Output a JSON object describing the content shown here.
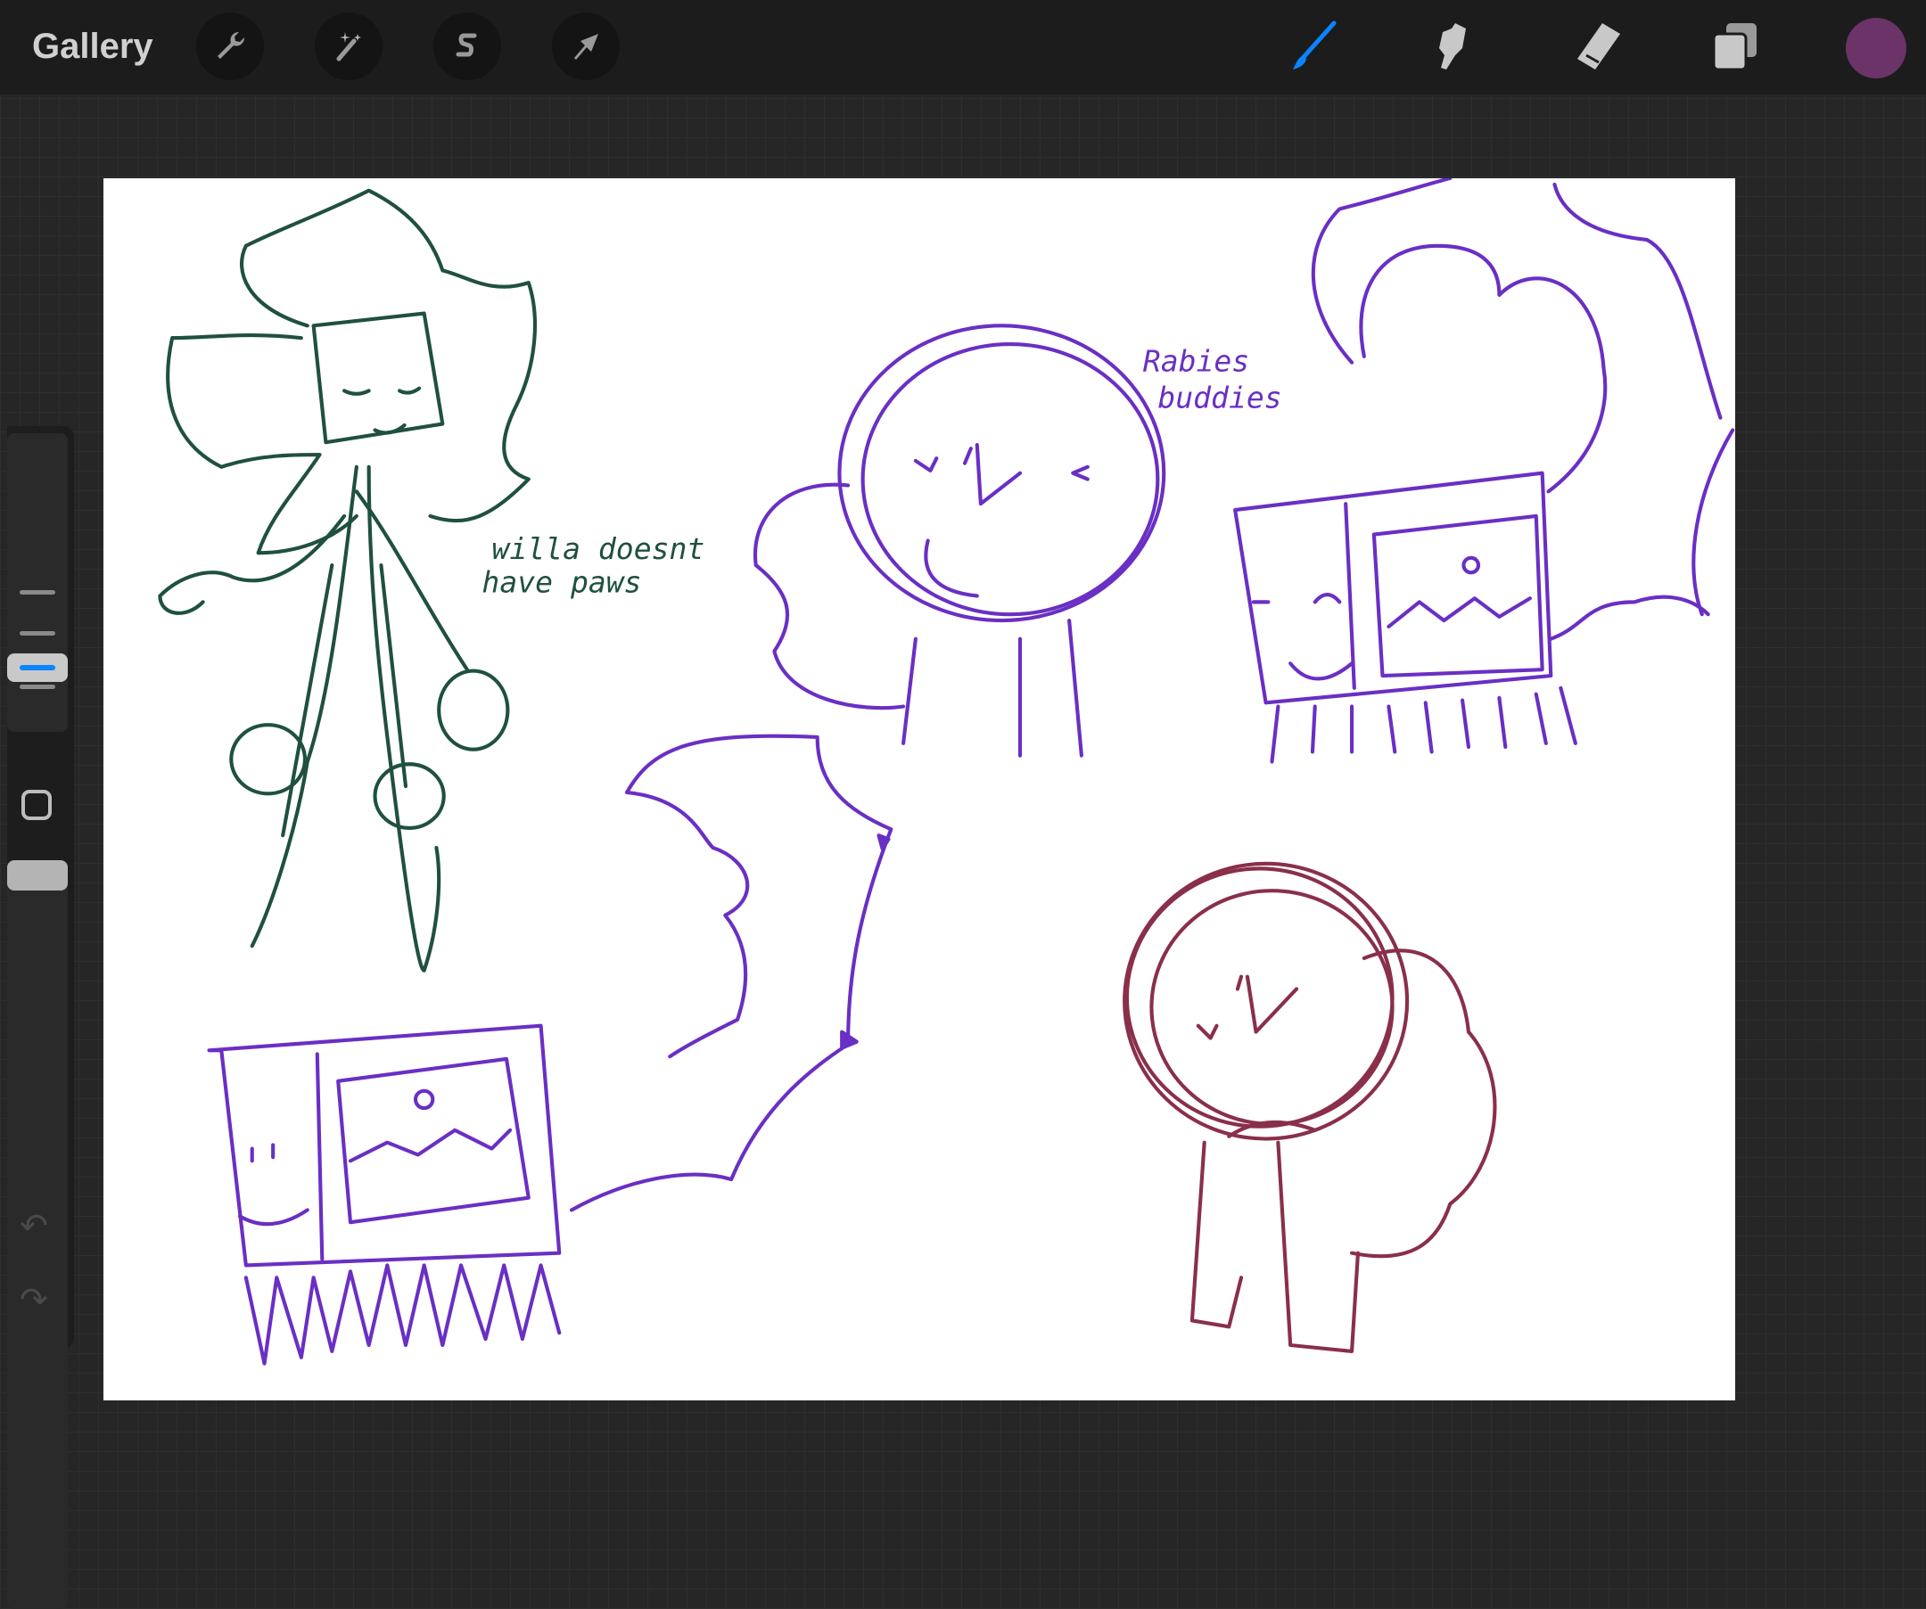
{
  "toolbar": {
    "gallery_label": "Gallery",
    "left_tools": [
      "wrench-icon",
      "magic-wand-icon",
      "selection-icon",
      "transform-arrow-icon"
    ],
    "right_tools": [
      "brush-icon",
      "smudge-icon",
      "eraser-icon",
      "layers-icon"
    ],
    "active_tool": "brush",
    "accent_color": "#0a84ff",
    "current_color": "#6b3367"
  },
  "sidebar": {
    "brush_size_level": 0.55,
    "opacity_level": 1.0
  },
  "canvas": {
    "note_green_line1": "willa doesnt",
    "note_green_line2": "have  paws",
    "note_purple_line1": "Rabies",
    "note_purple_line2": "buddies",
    "colors": {
      "green": "#1f5040",
      "purple": "#6a2fc4",
      "maroon": "#8a2f4a"
    }
  }
}
